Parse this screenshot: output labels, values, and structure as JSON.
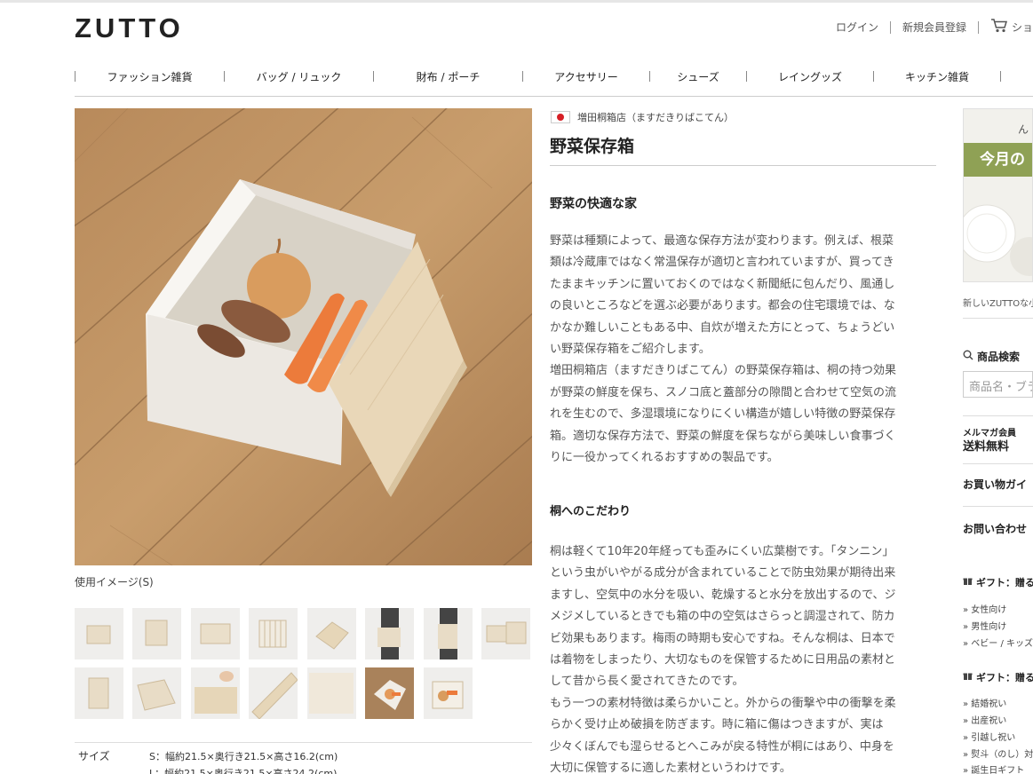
{
  "header": {
    "logo": "ZUTTO",
    "login": "ログイン",
    "register": "新規会員登録",
    "cart_label": "ショ"
  },
  "nav": [
    "ファッション雑貨",
    "バッグ / リュック",
    "財布 / ポーチ",
    "アクセサリー",
    "シューズ",
    "レイングッズ",
    "キッチン雑貨"
  ],
  "product": {
    "shop_name": "増田桐箱店（ますだきりばこてん）",
    "title": "野菜保存箱",
    "image_caption": "使用イメージ(S)",
    "thumbnails": [
      "thumb-1",
      "thumb-2",
      "thumb-3",
      "thumb-4",
      "thumb-5",
      "thumb-6",
      "thumb-7",
      "thumb-8",
      "thumb-9",
      "thumb-10",
      "thumb-11",
      "thumb-12",
      "thumb-13",
      "thumb-14",
      "thumb-15"
    ],
    "spec": {
      "label": "サイズ",
      "lines": [
        "S：幅約21.5×奥行き21.5×高さ16.2(cm)",
        "L：幅約21.5×奥行き21.5×高さ24.2(cm)"
      ]
    }
  },
  "description": {
    "heading1": "野菜の快適な家",
    "para1": [
      "野菜は種類によって、最適な保存方法が変わります。例えば、根菜",
      "類は冷蔵庫ではなく常温保存が適切と言われていますが、買ってき",
      "たままキッチンに置いておくのではなく新聞紙に包んだり、風通し",
      "の良いところなどを選ぶ必要があります。都会の住宅環境では、な",
      "かなか難しいこともある中、自炊が増えた方にとって、ちょうどい",
      "い野菜保存箱をご紹介します。",
      "増田桐箱店（ますだきりばこてん）の野菜保存箱は、桐の持つ効果",
      "が野菜の鮮度を保ち、スノコ底と蓋部分の隙間と合わせて空気の流",
      "れを生むので、多湿環境になりにくい構造が嬉しい特徴の野菜保存",
      "箱。適切な保存方法で、野菜の鮮度を保ちながら美味しい食事づく",
      "りに一役かってくれるおすすめの製品です。"
    ],
    "heading2": "桐へのこだわり",
    "para2": [
      "桐は軽くて10年20年経っても歪みにくい広葉樹です。「タンニン」",
      "という虫がいやがる成分が含まれていることで防虫効果が期待出来",
      "ますし、空気中の水分を吸い、乾燥すると水分を放出するので、ジ",
      "メジメしているときでも箱の中の空気はさらっと調湿されて、防カ",
      "ビ効果もあります。梅雨の時期も安心ですね。そんな桐は、日本で",
      "は着物をしまったり、大切なものを保管するために日用品の素材と",
      "して昔から長く愛されてきたのです。",
      "もう一つの素材特徴は柔らかいこと。外からの衝撃や中の衝撃を柔",
      "らかく受け止め破損を防ぎます。時に箱に傷はつきますが、実は",
      "少々くぼんでも湿らせるとへこみが戻る特性が桐にはあり、中身を",
      "大切に保管するに適した素材というわけです。"
    ]
  },
  "sidebar": {
    "banner_text": "今月の",
    "banner_corner": "ん",
    "banner_note": "新しいZUTTOな小",
    "search_title": "商品検索",
    "search_placeholder": "商品名・ブラ",
    "mail_member": "メルマガ会員",
    "free_shipping": "送料無料",
    "guide": "お買い物ガイ",
    "contact": "お問い合わせ",
    "gift1_title": "ギフト：贈る",
    "gift1_links": [
      "女性向け",
      "男性向け",
      "ベビー / キッズ"
    ],
    "gift2_title": "ギフト：贈る",
    "gift2_links": [
      "結婚祝い",
      "出産祝い",
      "引越し祝い",
      "熨斗（のし）対",
      "誕生日ギフト"
    ]
  },
  "colors": {
    "accent_green": "#8fa155",
    "flag_red": "#d61f26",
    "floor_wood": "#b8895a"
  }
}
